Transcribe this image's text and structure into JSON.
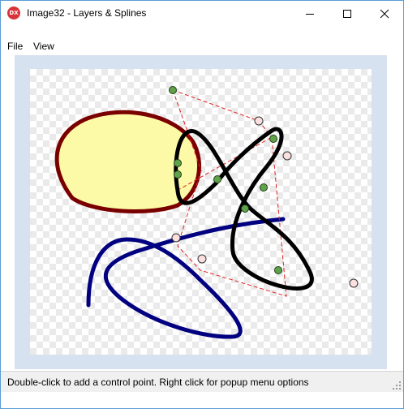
{
  "window": {
    "title": "Image32 - Layers & Splines",
    "icon_text": "DX"
  },
  "menu": {
    "items": [
      "File",
      "View"
    ]
  },
  "status": {
    "text": "Double-click to add a control point. Right click for popup menu options"
  },
  "colors": {
    "blob_fill": "#fdfaa7",
    "blob_stroke": "#7a0000",
    "blue_spline": "#000080",
    "black_spline": "#000000",
    "control_line": "#e02020",
    "point_fill": "#5fa24a",
    "ghost_point_fill": "#fbe0e0"
  },
  "icons": [
    "app-icon",
    "minimize-icon",
    "maximize-icon",
    "close-icon",
    "size-grip-icon"
  ]
}
